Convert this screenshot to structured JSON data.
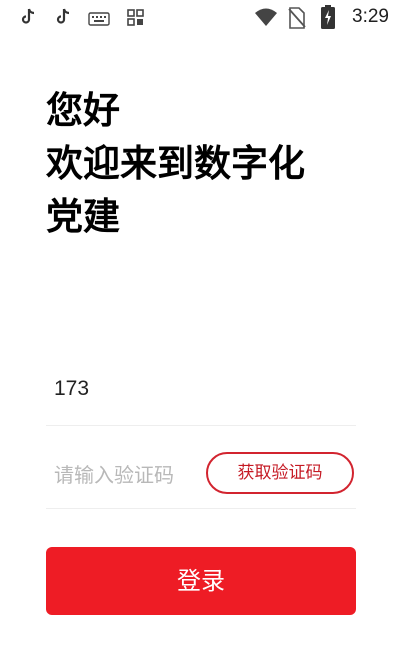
{
  "status_bar": {
    "icons_left": [
      "tiktok-icon",
      "tiktok-icon",
      "keyboard-icon",
      "apps-icon"
    ],
    "icons_right": [
      "wifi-icon",
      "no-sim-icon",
      "battery-charging-icon"
    ],
    "time": "3:29"
  },
  "greeting": {
    "line1": "您好",
    "line2": "欢迎来到数字化",
    "line3": "党建"
  },
  "form": {
    "phone_value": "173",
    "code_placeholder": "请输入验证码",
    "get_code_label": "获取验证码",
    "login_label": "登录"
  },
  "colors": {
    "accent": "#ee1c25",
    "get_code_border": "#d2242f",
    "placeholder": "#b8b8b8"
  }
}
